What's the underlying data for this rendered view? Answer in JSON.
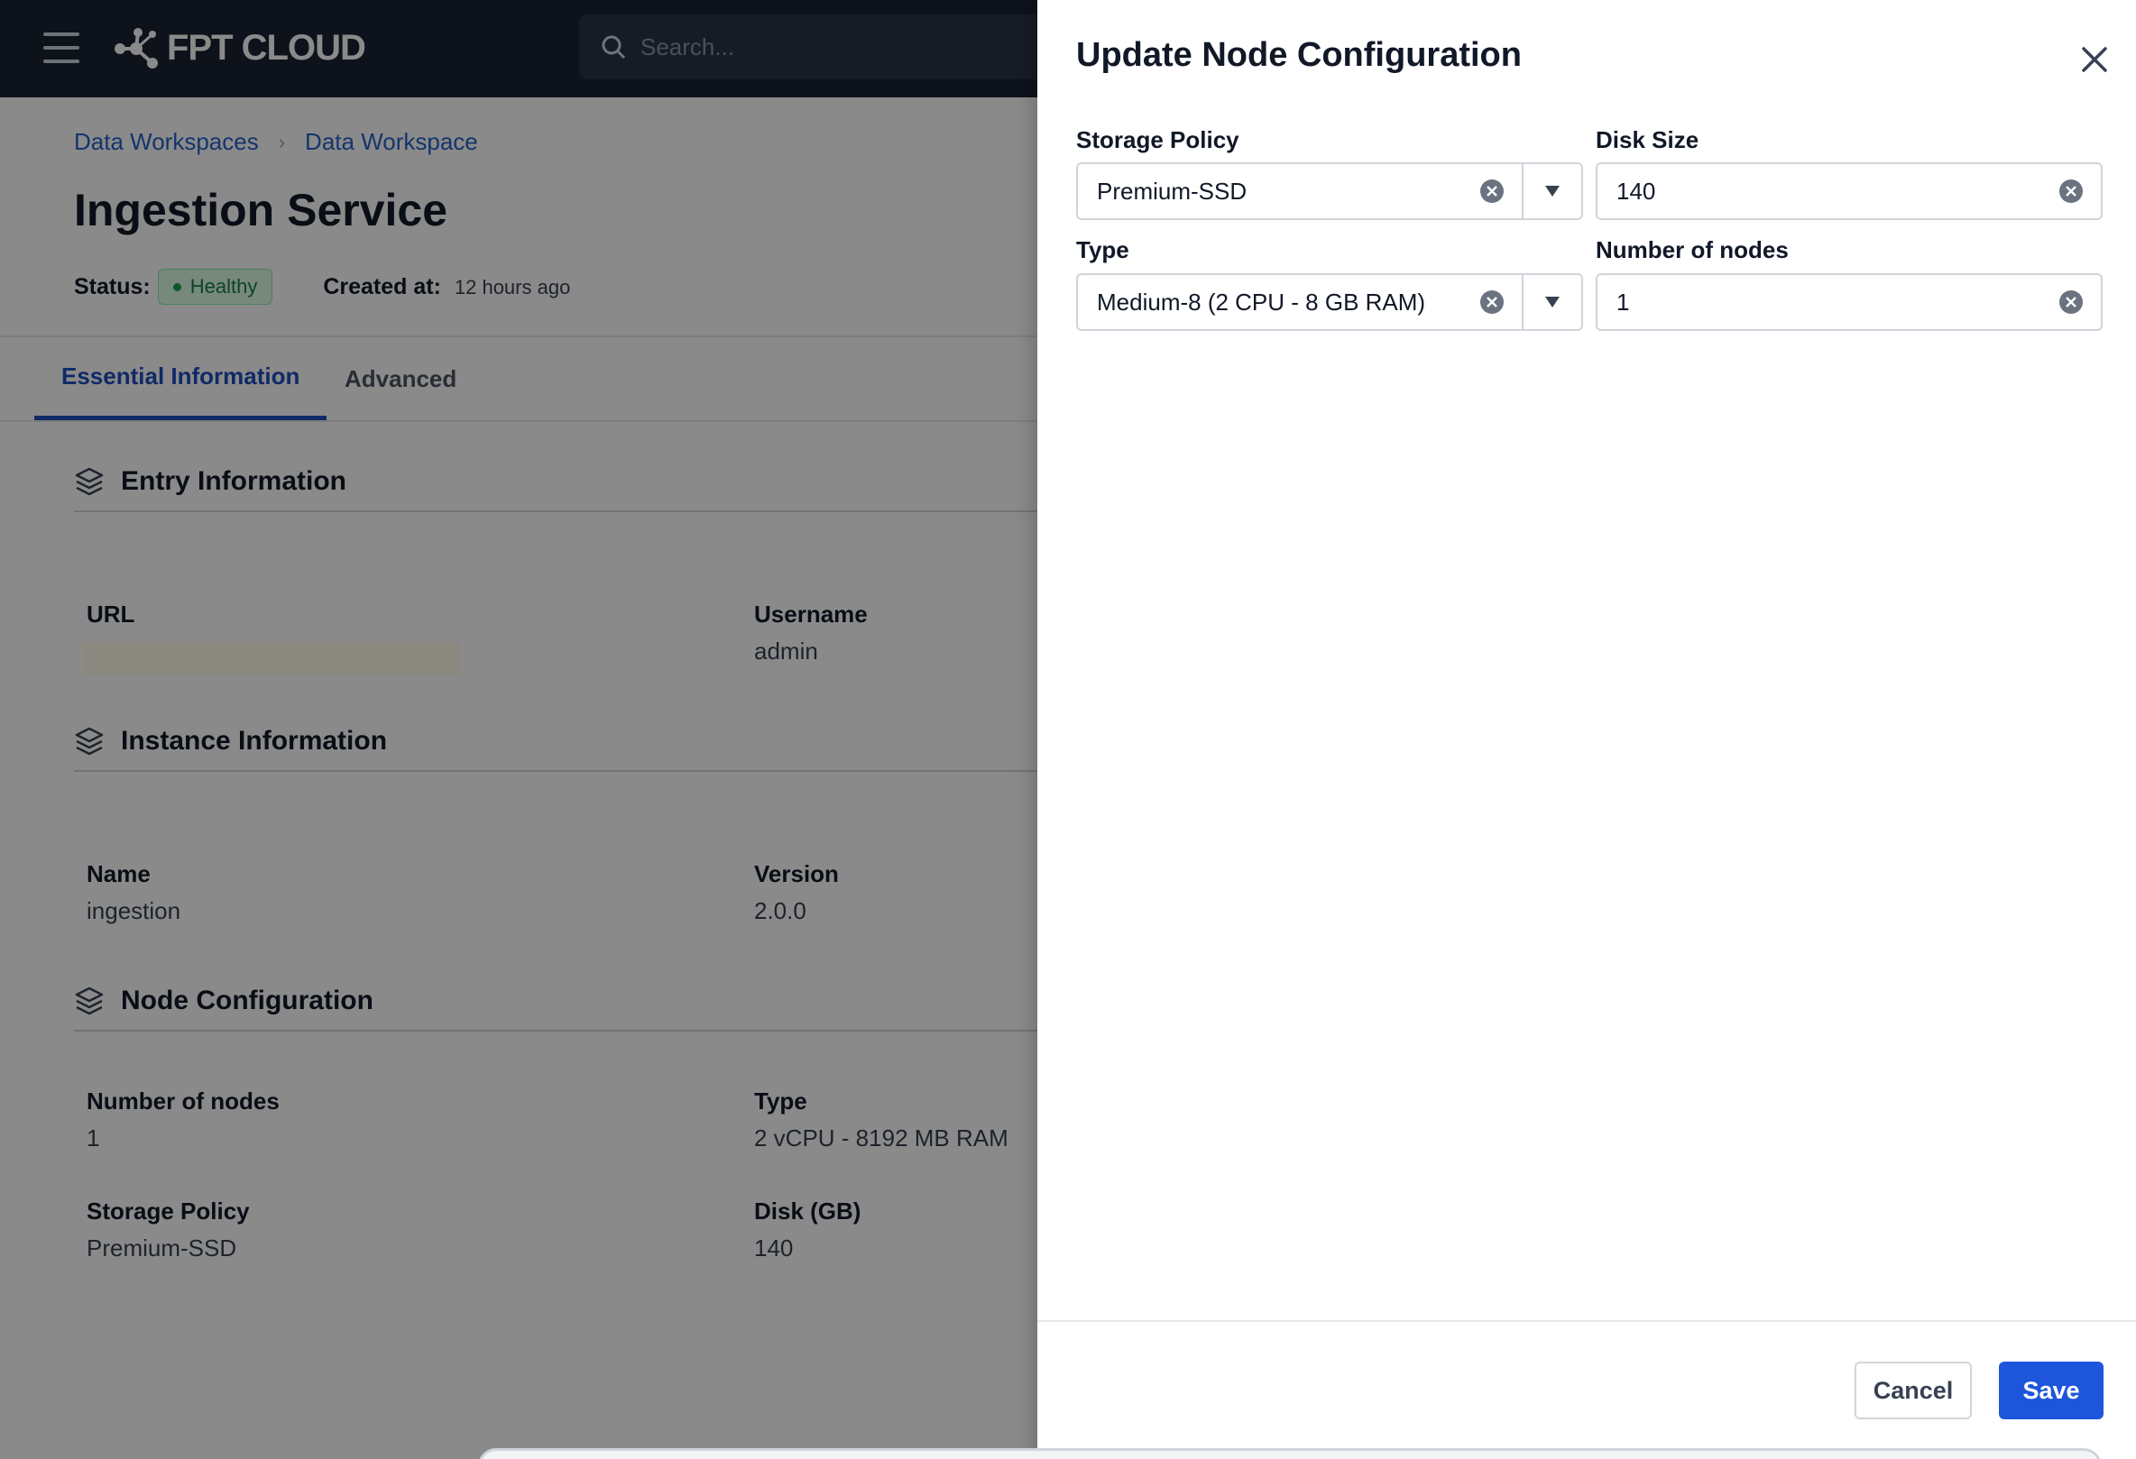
{
  "header": {
    "logo_text": "FPT CLOUD",
    "search_placeholder": "Search..."
  },
  "breadcrumb": [
    "Data Workspaces",
    "Data Workspace"
  ],
  "page": {
    "title": "Ingestion Service",
    "status_label": "Status:",
    "status_value": "Healthy",
    "created_label": "Created at:",
    "created_value": "12 hours ago"
  },
  "tabs": [
    {
      "label": "Essential Information",
      "active": true
    },
    {
      "label": "Advanced",
      "active": false
    }
  ],
  "sections": {
    "entry": {
      "title": "Entry Information",
      "url_label": "URL",
      "username_label": "Username",
      "username_value": "admin"
    },
    "instance": {
      "title": "Instance Information",
      "name_label": "Name",
      "name_value": "ingestion",
      "version_label": "Version",
      "version_value": "2.0.0"
    },
    "node": {
      "title": "Node Configuration",
      "nodes_label": "Number of nodes",
      "nodes_value": "1",
      "type_label": "Type",
      "type_value": "2 vCPU - 8192 MB RAM",
      "storage_label": "Storage Policy",
      "storage_value": "Premium-SSD",
      "disk_label": "Disk (GB)",
      "disk_value": "140"
    }
  },
  "drawer": {
    "title": "Update Node Configuration",
    "storage_policy_label": "Storage Policy",
    "storage_policy_value": "Premium-SSD",
    "disk_size_label": "Disk Size",
    "disk_size_value": "140",
    "type_label": "Type",
    "type_value": "Medium-8 (2 CPU - 8 GB RAM)",
    "nodes_label": "Number of nodes",
    "nodes_value": "1",
    "cancel_label": "Cancel",
    "save_label": "Save"
  },
  "colors": {
    "topbar": "#1a2233",
    "accent": "#1d56db",
    "link": "#2563c9",
    "healthy": "#16a34a"
  }
}
